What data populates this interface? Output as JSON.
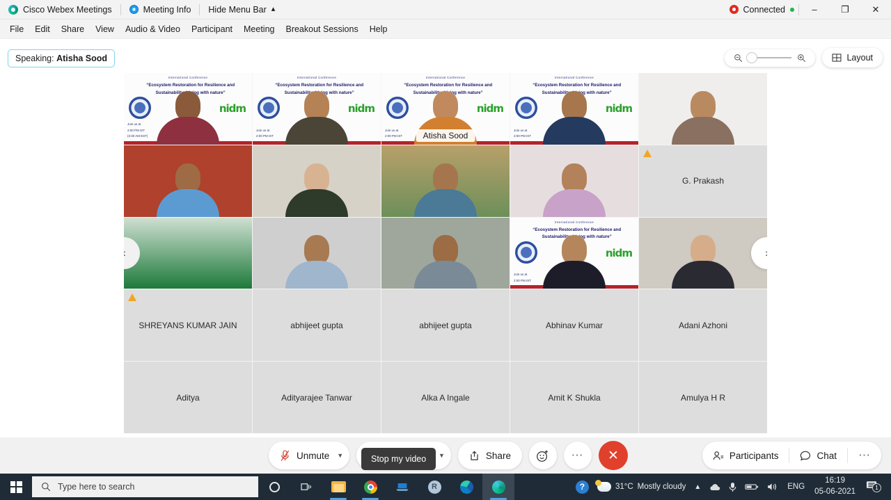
{
  "titlebar": {
    "app_name": "Cisco Webex Meetings",
    "meeting_info": "Meeting Info",
    "hide_menu_bar": "Hide Menu Bar",
    "connected": "Connected",
    "minimize": "–",
    "maximize": "❐",
    "close": "✕"
  },
  "menubar": {
    "items": [
      {
        "label": "File"
      },
      {
        "label": "Edit"
      },
      {
        "label": "Share"
      },
      {
        "label": "View"
      },
      {
        "label": "Audio & Video"
      },
      {
        "label": "Participant"
      },
      {
        "label": "Meeting"
      },
      {
        "label": "Breakout Sessions"
      },
      {
        "label": "Help"
      }
    ]
  },
  "stage": {
    "speaking_prefix": "Speaking:",
    "speaking_name": "Atisha Sood",
    "layout_label": "Layout",
    "nav_prev": "‹",
    "nav_next": "›",
    "tooltip": "Stop my video",
    "active_speaker_label": "Atisha Sood",
    "slide": {
      "header": "International Conference",
      "title": "“Ecosystem Restoration for Resilience and Sustainability: Living with nature”",
      "logo": "nidm",
      "join_line1": "Join us at",
      "join_line2": "2:00 PM IST",
      "join_line3": "(3:30 AM EST)"
    },
    "tiles": [
      {
        "row": 1,
        "video": true,
        "name": "",
        "warn": false,
        "active": false,
        "bg": "slide",
        "skin": "#8a5a3b",
        "shirt": "#8e3040"
      },
      {
        "row": 1,
        "video": true,
        "name": "",
        "warn": false,
        "active": false,
        "bg": "slide",
        "skin": "#b58256",
        "shirt": "#4a4536"
      },
      {
        "row": 1,
        "video": true,
        "name": "Atisha Sood",
        "warn": false,
        "active": true,
        "bg": "slide",
        "skin": "#c08a5e",
        "shirt": "#d2802f"
      },
      {
        "row": 1,
        "video": true,
        "name": "",
        "warn": false,
        "active": false,
        "bg": "slide",
        "skin": "#a8764c",
        "shirt": "#243a5e"
      },
      {
        "row": 1,
        "video": true,
        "name": "",
        "warn": false,
        "active": false,
        "bg": "plain",
        "skin": "#b98a60",
        "shirt": "#8a7060"
      },
      {
        "row": 2,
        "video": true,
        "name": "",
        "warn": false,
        "active": false,
        "bg": "plain",
        "skin": "#9e6b45",
        "shirt": "#5c9bd1"
      },
      {
        "row": 2,
        "video": true,
        "name": "",
        "warn": false,
        "active": false,
        "bg": "plain",
        "skin": "#d8b392",
        "shirt": "#2e3a2a"
      },
      {
        "row": 2,
        "video": true,
        "name": "",
        "warn": false,
        "active": false,
        "bg": "plain",
        "skin": "#a5764e",
        "shirt": "#4a7a96"
      },
      {
        "row": 2,
        "video": true,
        "name": "",
        "warn": false,
        "active": false,
        "bg": "plain",
        "skin": "#b3825a",
        "shirt": "#c8a2c8"
      },
      {
        "row": 2,
        "video": false,
        "name": "G. Prakash",
        "warn": true,
        "active": false,
        "bg": "none",
        "skin": "",
        "shirt": ""
      },
      {
        "row": 3,
        "video": true,
        "name": "",
        "warn": false,
        "active": false,
        "bg": "plain",
        "skin": "",
        "shirt": ""
      },
      {
        "row": 3,
        "video": true,
        "name": "",
        "warn": false,
        "active": false,
        "bg": "plain",
        "skin": "#a87a52",
        "shirt": "#9fb6cc"
      },
      {
        "row": 3,
        "video": true,
        "name": "",
        "warn": false,
        "active": false,
        "bg": "plain",
        "skin": "#9c6c44",
        "shirt": "#7a8a96"
      },
      {
        "row": 3,
        "video": true,
        "name": "",
        "warn": false,
        "active": false,
        "bg": "slide",
        "skin": "#b5865c",
        "shirt": "#1d1d2a"
      },
      {
        "row": 3,
        "video": true,
        "name": "",
        "warn": false,
        "active": false,
        "bg": "plain",
        "skin": "#d5ad8a",
        "shirt": "#2a2a33"
      },
      {
        "row": 4,
        "video": false,
        "name": "SHREYANS KUMAR JAIN",
        "warn": true,
        "active": false,
        "bg": "none",
        "skin": "",
        "shirt": ""
      },
      {
        "row": 4,
        "video": false,
        "name": "abhijeet gupta",
        "warn": false,
        "active": false,
        "bg": "none",
        "skin": "",
        "shirt": ""
      },
      {
        "row": 4,
        "video": false,
        "name": "abhijeet gupta",
        "warn": false,
        "active": false,
        "bg": "none",
        "skin": "",
        "shirt": ""
      },
      {
        "row": 4,
        "video": false,
        "name": "Abhinav Kumar",
        "warn": false,
        "active": false,
        "bg": "none",
        "skin": "",
        "shirt": ""
      },
      {
        "row": 4,
        "video": false,
        "name": "Adani Azhoni",
        "warn": false,
        "active": false,
        "bg": "none",
        "skin": "",
        "shirt": ""
      },
      {
        "row": 5,
        "video": false,
        "name": "Aditya",
        "warn": false,
        "active": false,
        "bg": "none",
        "skin": "",
        "shirt": ""
      },
      {
        "row": 5,
        "video": false,
        "name": "Adityarajee Tanwar",
        "warn": false,
        "active": false,
        "bg": "none",
        "skin": "",
        "shirt": ""
      },
      {
        "row": 5,
        "video": false,
        "name": "Alka A Ingale",
        "warn": false,
        "active": false,
        "bg": "none",
        "skin": "",
        "shirt": ""
      },
      {
        "row": 5,
        "video": false,
        "name": "Amit K Shukla",
        "warn": false,
        "active": false,
        "bg": "none",
        "skin": "",
        "shirt": ""
      },
      {
        "row": 5,
        "video": false,
        "name": "Amulya H R",
        "warn": false,
        "active": false,
        "bg": "none",
        "skin": "",
        "shirt": ""
      }
    ]
  },
  "controls": {
    "unmute": "Unmute",
    "stop_video": "Stop video",
    "share": "Share",
    "reactions_icon": "smiley-plus-icon",
    "more_icon": "ellipsis-icon",
    "end_icon": "✕",
    "participants": "Participants",
    "chat": "Chat",
    "more_right": "⋯"
  },
  "taskbar": {
    "search_placeholder": "Type here to search",
    "weather_temp": "31°C",
    "weather_desc": "Mostly cloudy",
    "language": "ENG",
    "time": "16:19",
    "date": "05-06-2021",
    "notification_count": "1"
  },
  "colors": {
    "accent": "#2fb3e0",
    "end_call": "#e0402c",
    "warning": "#f0a623",
    "connected": "#19b84b",
    "taskbar": "#1f2c38"
  }
}
